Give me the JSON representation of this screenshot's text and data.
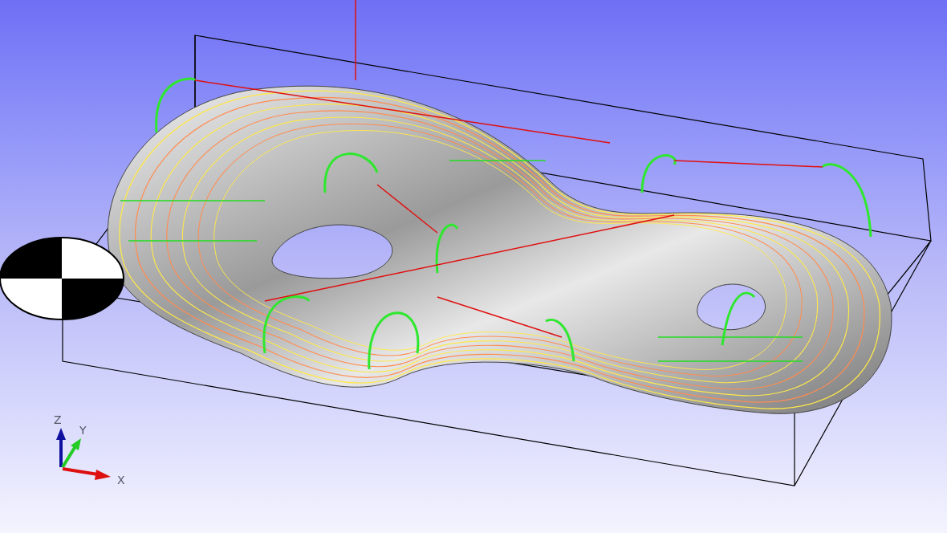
{
  "viewport": {
    "axis_labels": [
      {
        "text": "Z"
      },
      {
        "text": "Y"
      },
      {
        "text": "X"
      }
    ]
  }
}
